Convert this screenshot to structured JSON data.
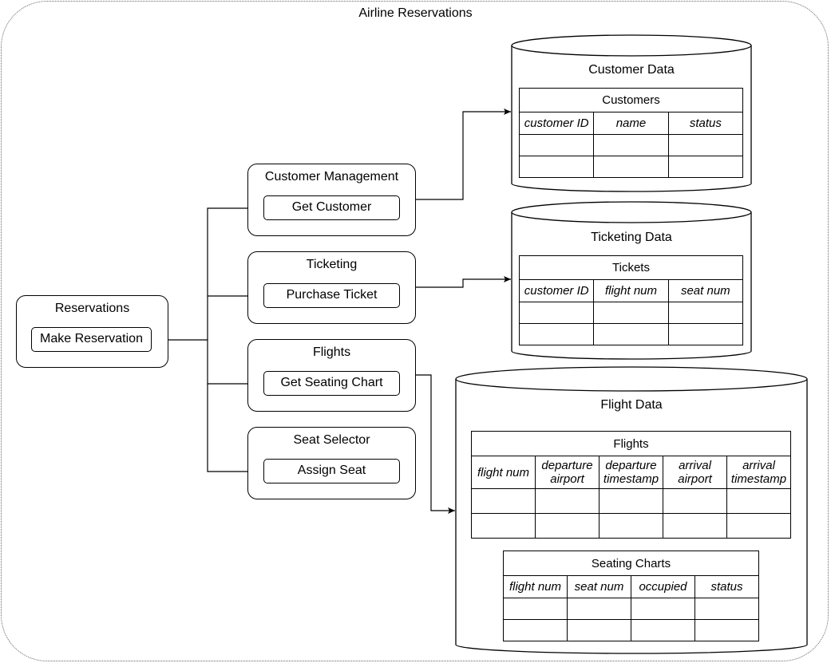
{
  "diagram": {
    "title": "Airline Reservations",
    "services": [
      {
        "name": "Reservations",
        "operations": [
          "Make Reservation"
        ]
      },
      {
        "name": "Customer Management",
        "operations": [
          "Get Customer"
        ]
      },
      {
        "name": "Ticketing",
        "operations": [
          "Purchase Ticket"
        ]
      },
      {
        "name": "Flights",
        "operations": [
          "Get Seating Chart"
        ]
      },
      {
        "name": "Seat Selector",
        "operations": [
          "Assign Seat"
        ]
      }
    ],
    "databases": [
      {
        "name": "Customer Data",
        "tables": [
          {
            "name": "Customers",
            "columns": [
              "customer ID",
              "name",
              "status"
            ],
            "empty_rows": 2
          }
        ]
      },
      {
        "name": "Ticketing Data",
        "tables": [
          {
            "name": "Tickets",
            "columns": [
              "customer ID",
              "flight num",
              "seat num"
            ],
            "empty_rows": 2
          }
        ]
      },
      {
        "name": "Flight Data",
        "tables": [
          {
            "name": "Flights",
            "columns": [
              "flight num",
              "departure airport",
              "departure timestamp",
              "arrival airport",
              "arrival timestamp"
            ],
            "empty_rows": 2
          },
          {
            "name": "Seating Charts",
            "columns": [
              "flight num",
              "seat num",
              "occupied",
              "status"
            ],
            "empty_rows": 2
          }
        ]
      }
    ],
    "connections": [
      {
        "from": "Make Reservation",
        "to": "Get Customer"
      },
      {
        "from": "Make Reservation",
        "to": "Purchase Ticket"
      },
      {
        "from": "Make Reservation",
        "to": "Get Seating Chart"
      },
      {
        "from": "Make Reservation",
        "to": "Assign Seat"
      },
      {
        "from": "Customer Management",
        "to": "Customer Data"
      },
      {
        "from": "Ticketing",
        "to": "Ticketing Data"
      },
      {
        "from": "Flights",
        "to": "Flight Data"
      }
    ]
  }
}
